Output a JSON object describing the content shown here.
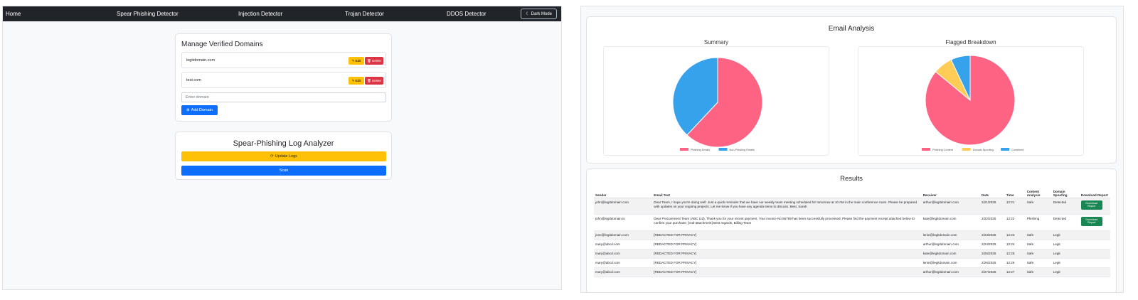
{
  "left_app": {
    "nav": {
      "home": "Home",
      "spear": "Spear Phishing Detector",
      "injection": "Injection Detector",
      "trojan": "Trojan Detector",
      "ddos": "DDOS Detector",
      "dark_mode": "Dark Mode"
    },
    "domains": {
      "title": "Manage Verified Domains",
      "items": [
        {
          "domain": "legitdomain.com",
          "edit": "Edit",
          "delete": "Delete"
        },
        {
          "domain": "test.com",
          "edit": "Edit",
          "delete": "Delete"
        }
      ],
      "input_placeholder": "Enter domain",
      "add_label": "Add Domain"
    },
    "analyzer": {
      "title": "Spear-Phishing Log Analyzer",
      "update_label": "Update Logs",
      "scan_label": "Scan"
    }
  },
  "right_app": {
    "analysis_title": "Email Analysis",
    "summary_title": "Summary",
    "flagged_title": "Flagged Breakdown",
    "results_title": "Results",
    "table_headers": [
      "Sender",
      "Email Text",
      "Receiver",
      "Date",
      "Time",
      "Content Analysis",
      "Domain Spoofing",
      "Download Report"
    ],
    "rows": [
      {
        "sender": "john@legitdomain.com",
        "text": "Dear Team, I hope you're doing well. Just a quick reminder that we have our weekly team meeting scheduled for tomorrow at 10 AM in the main conference room. Please be prepared with updates on your ongoing projects. Let me know if you have any agenda items to discuss. Best, Sarah",
        "receiver": "arthur@legitdomain.com",
        "date": "2/21/2025",
        "time": "12:21",
        "content": "Safe",
        "spoofing": "Detected",
        "download": "Download Report"
      },
      {
        "sender": "john@legitdomain.io",
        "text": "Dear Procurement Team (ABC Ltd), Thank you for your recent payment. Your invoice No.56789 has been successfully processed. Please find the payment receipt attached below to confirm your purchase. [real-attachment] Best regards, Billing Team",
        "receiver": "kate@legitdomain.com",
        "date": "2/22/2025",
        "time": "12:22",
        "content": "Phishing",
        "spoofing": "Detected",
        "download": "Download Report"
      },
      {
        "sender": "jone@legitdomain.com",
        "text": "[REDACTED FOR PRIVACY]",
        "receiver": "lenin@legitdomain.com",
        "date": "2/23/2025",
        "time": "12:23",
        "content": "Safe",
        "spoofing": "Legit",
        "download": ""
      },
      {
        "sender": "mary@abcd.com",
        "text": "[REDACTED FOR PRIVACY]",
        "receiver": "arthur@legitdomain.com",
        "date": "2/24/2025",
        "time": "12:24",
        "content": "Safe",
        "spoofing": "Legit",
        "download": ""
      },
      {
        "sender": "mary@abcd.com",
        "text": "[REDACTED FOR PRIVACY]",
        "receiver": "kate@legitdomain.com",
        "date": "2/25/2025",
        "time": "12:25",
        "content": "Safe",
        "spoofing": "Legit",
        "download": ""
      },
      {
        "sender": "mary@abcd.com",
        "text": "[REDACTED FOR PRIVACY]",
        "receiver": "lenin@legitdomain.com",
        "date": "2/26/2025",
        "time": "12:26",
        "content": "Safe",
        "spoofing": "Legit",
        "download": ""
      },
      {
        "sender": "mary@abcd.com",
        "text": "[REDACTED FOR PRIVACY]",
        "receiver": "arthur@legitdomain.com",
        "date": "2/27/2025",
        "time": "12:27",
        "content": "Safe",
        "spoofing": "Legit",
        "download": ""
      }
    ]
  },
  "colors": {
    "pink": "#ff6384",
    "blue": "#36a2eb",
    "yellow": "#ffcd56",
    "navbar": "#212529",
    "primary": "#0d6efd",
    "warning": "#ffc107",
    "danger": "#dc3545",
    "success": "#198754"
  },
  "chart_data": [
    {
      "type": "pie",
      "title": "Summary",
      "categories": [
        "Phishing Emails",
        "Non-Phishing Emails"
      ],
      "values": [
        62,
        38
      ],
      "colors": [
        "#ff6384",
        "#36a2eb"
      ],
      "legend": "bottom"
    },
    {
      "type": "pie",
      "title": "Flagged Breakdown",
      "categories": [
        "Phishing Content",
        "Domain Spoofing",
        "Combined"
      ],
      "values": [
        86,
        7,
        7
      ],
      "colors": [
        "#ff6384",
        "#ffcd56",
        "#36a2eb"
      ],
      "legend": "bottom"
    }
  ]
}
